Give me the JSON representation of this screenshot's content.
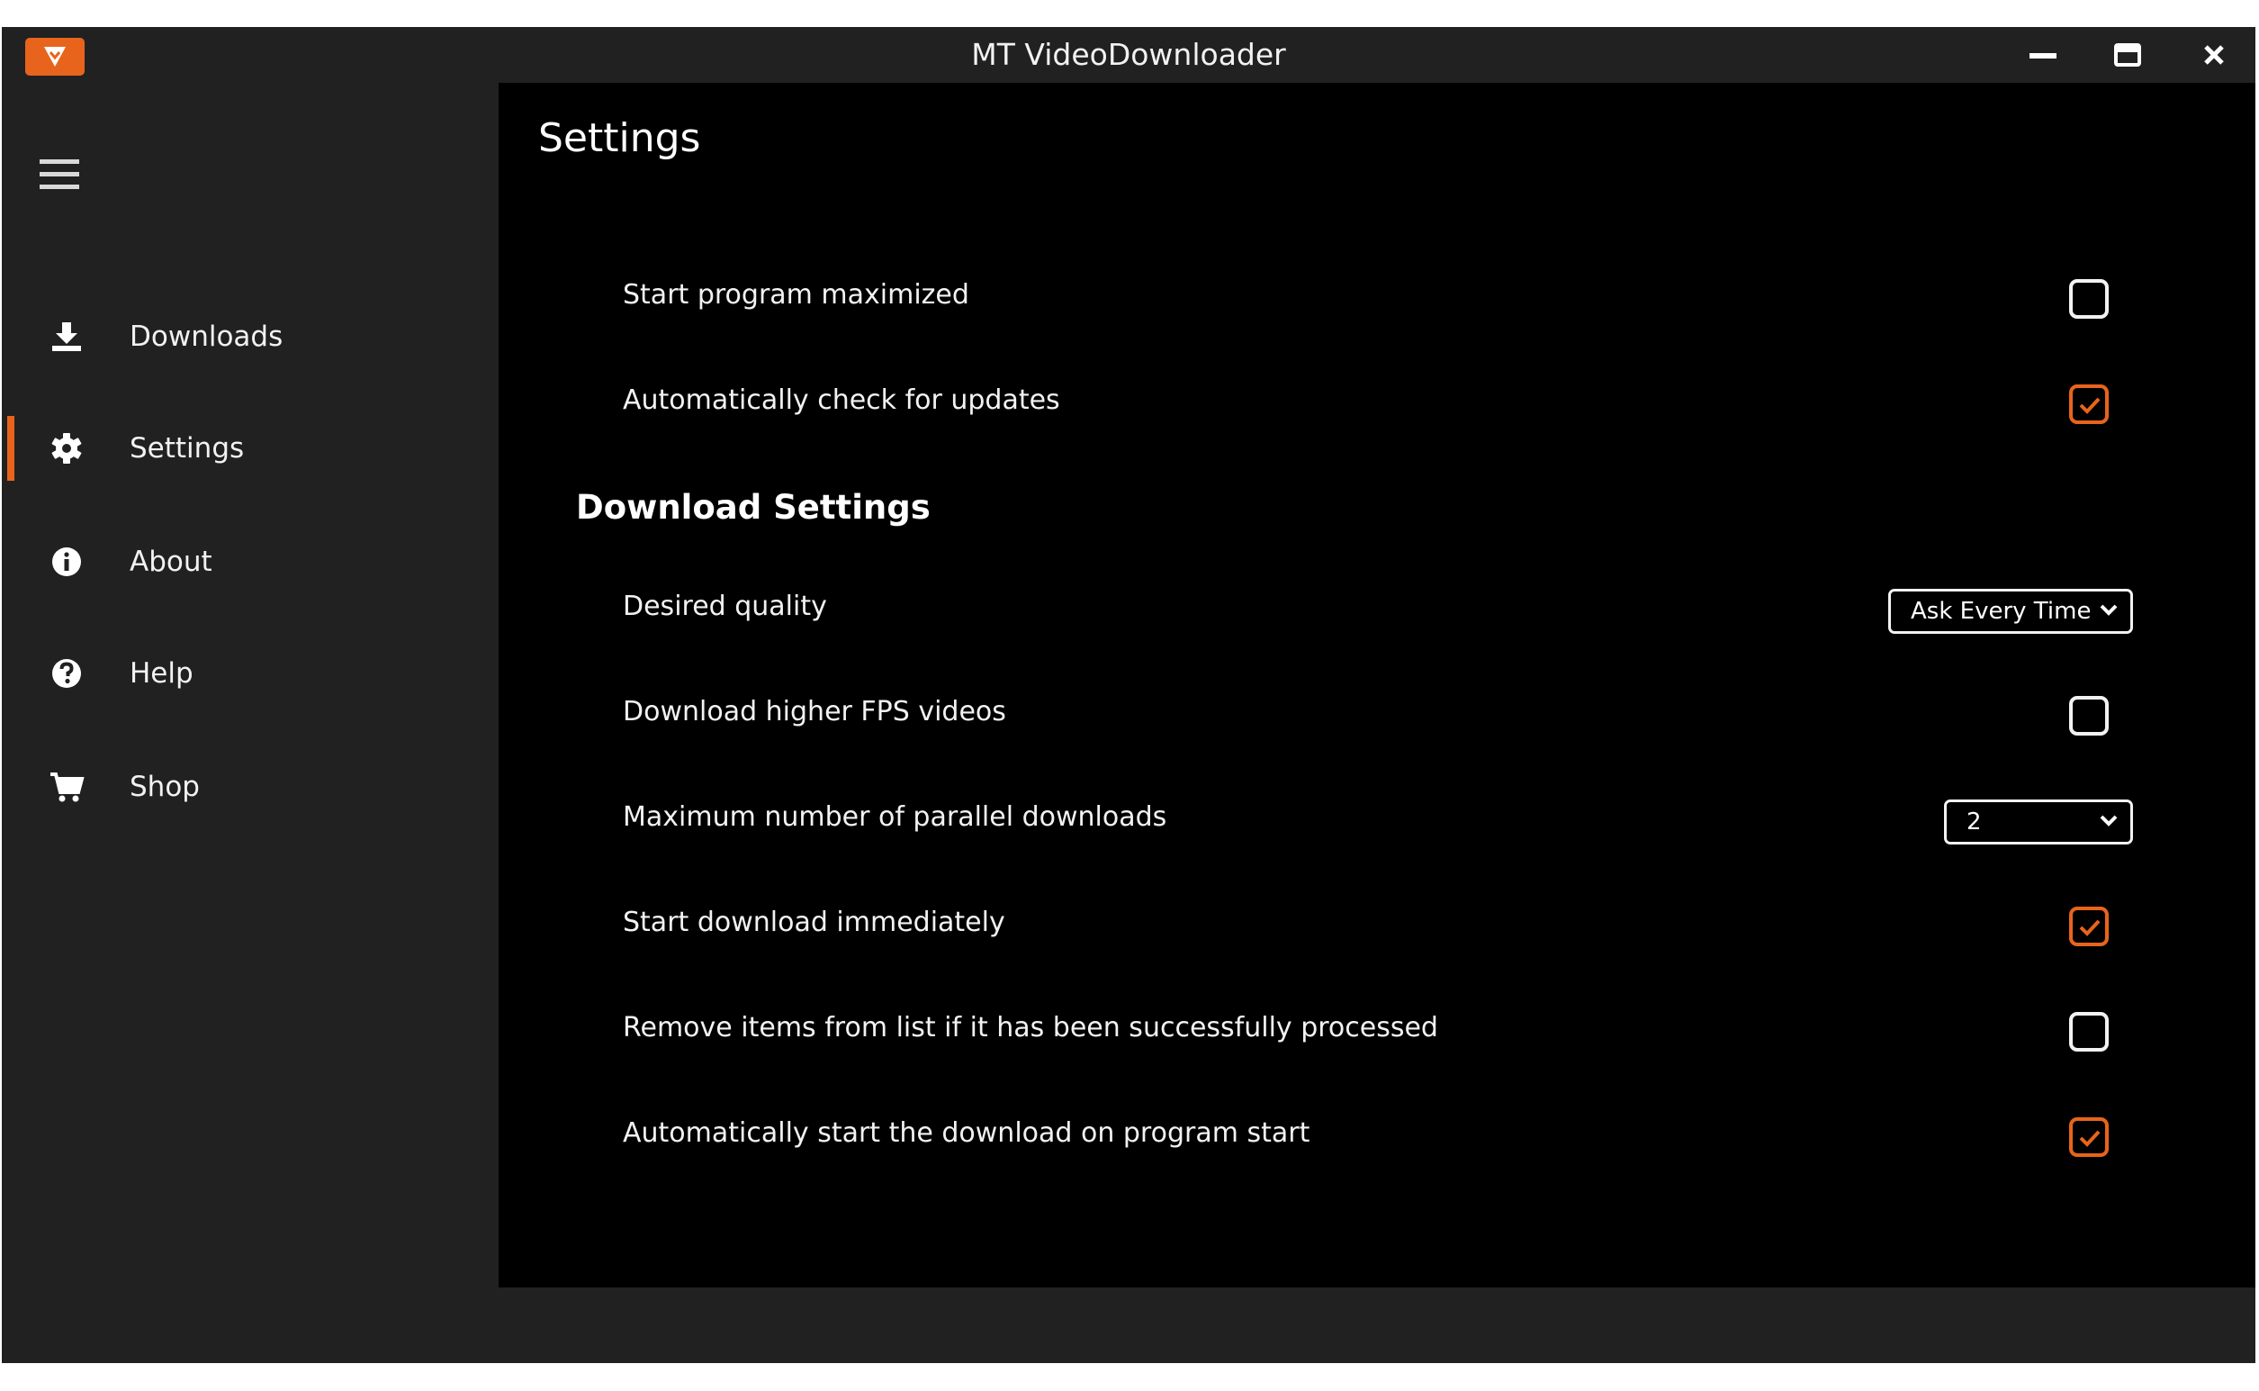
{
  "window": {
    "title": "MT VideoDownloader",
    "controls": [
      "minimize-icon",
      "maximize-icon",
      "close-icon"
    ]
  },
  "sidebar": {
    "menu_icon": "hamburger-icon",
    "items": [
      {
        "label": "Downloads",
        "icon": "download-icon",
        "active": false
      },
      {
        "label": "Settings",
        "icon": "gear-icon",
        "active": true
      },
      {
        "label": "About",
        "icon": "info-icon",
        "active": false
      },
      {
        "label": "Help",
        "icon": "question-icon",
        "active": false
      },
      {
        "label": "Shop",
        "icon": "cart-icon",
        "active": false
      }
    ]
  },
  "settings": {
    "title": "Settings",
    "general": [
      {
        "label": "Start program maximized",
        "checked": false
      },
      {
        "label": "Automatically check for updates",
        "checked": true
      }
    ],
    "download_section_title": "Download Settings",
    "desired_quality": {
      "label": "Desired quality",
      "value": "Ask Every Time"
    },
    "higher_fps": {
      "label": "Download higher FPS videos",
      "checked": false
    },
    "parallel_downloads": {
      "label": "Maximum number of parallel downloads",
      "value": "2"
    },
    "start_immediately": {
      "label": "Start download immediately",
      "checked": true
    },
    "remove_processed": {
      "label": "Remove items from list if it has been successfully processed",
      "checked": false
    },
    "autostart": {
      "label": "Automatically start the download on program start",
      "checked": true
    }
  },
  "colors": {
    "accent": "#e8641c",
    "sidebar_bg": "#212121",
    "main_bg": "#000000",
    "text": "#f2f2f2"
  }
}
